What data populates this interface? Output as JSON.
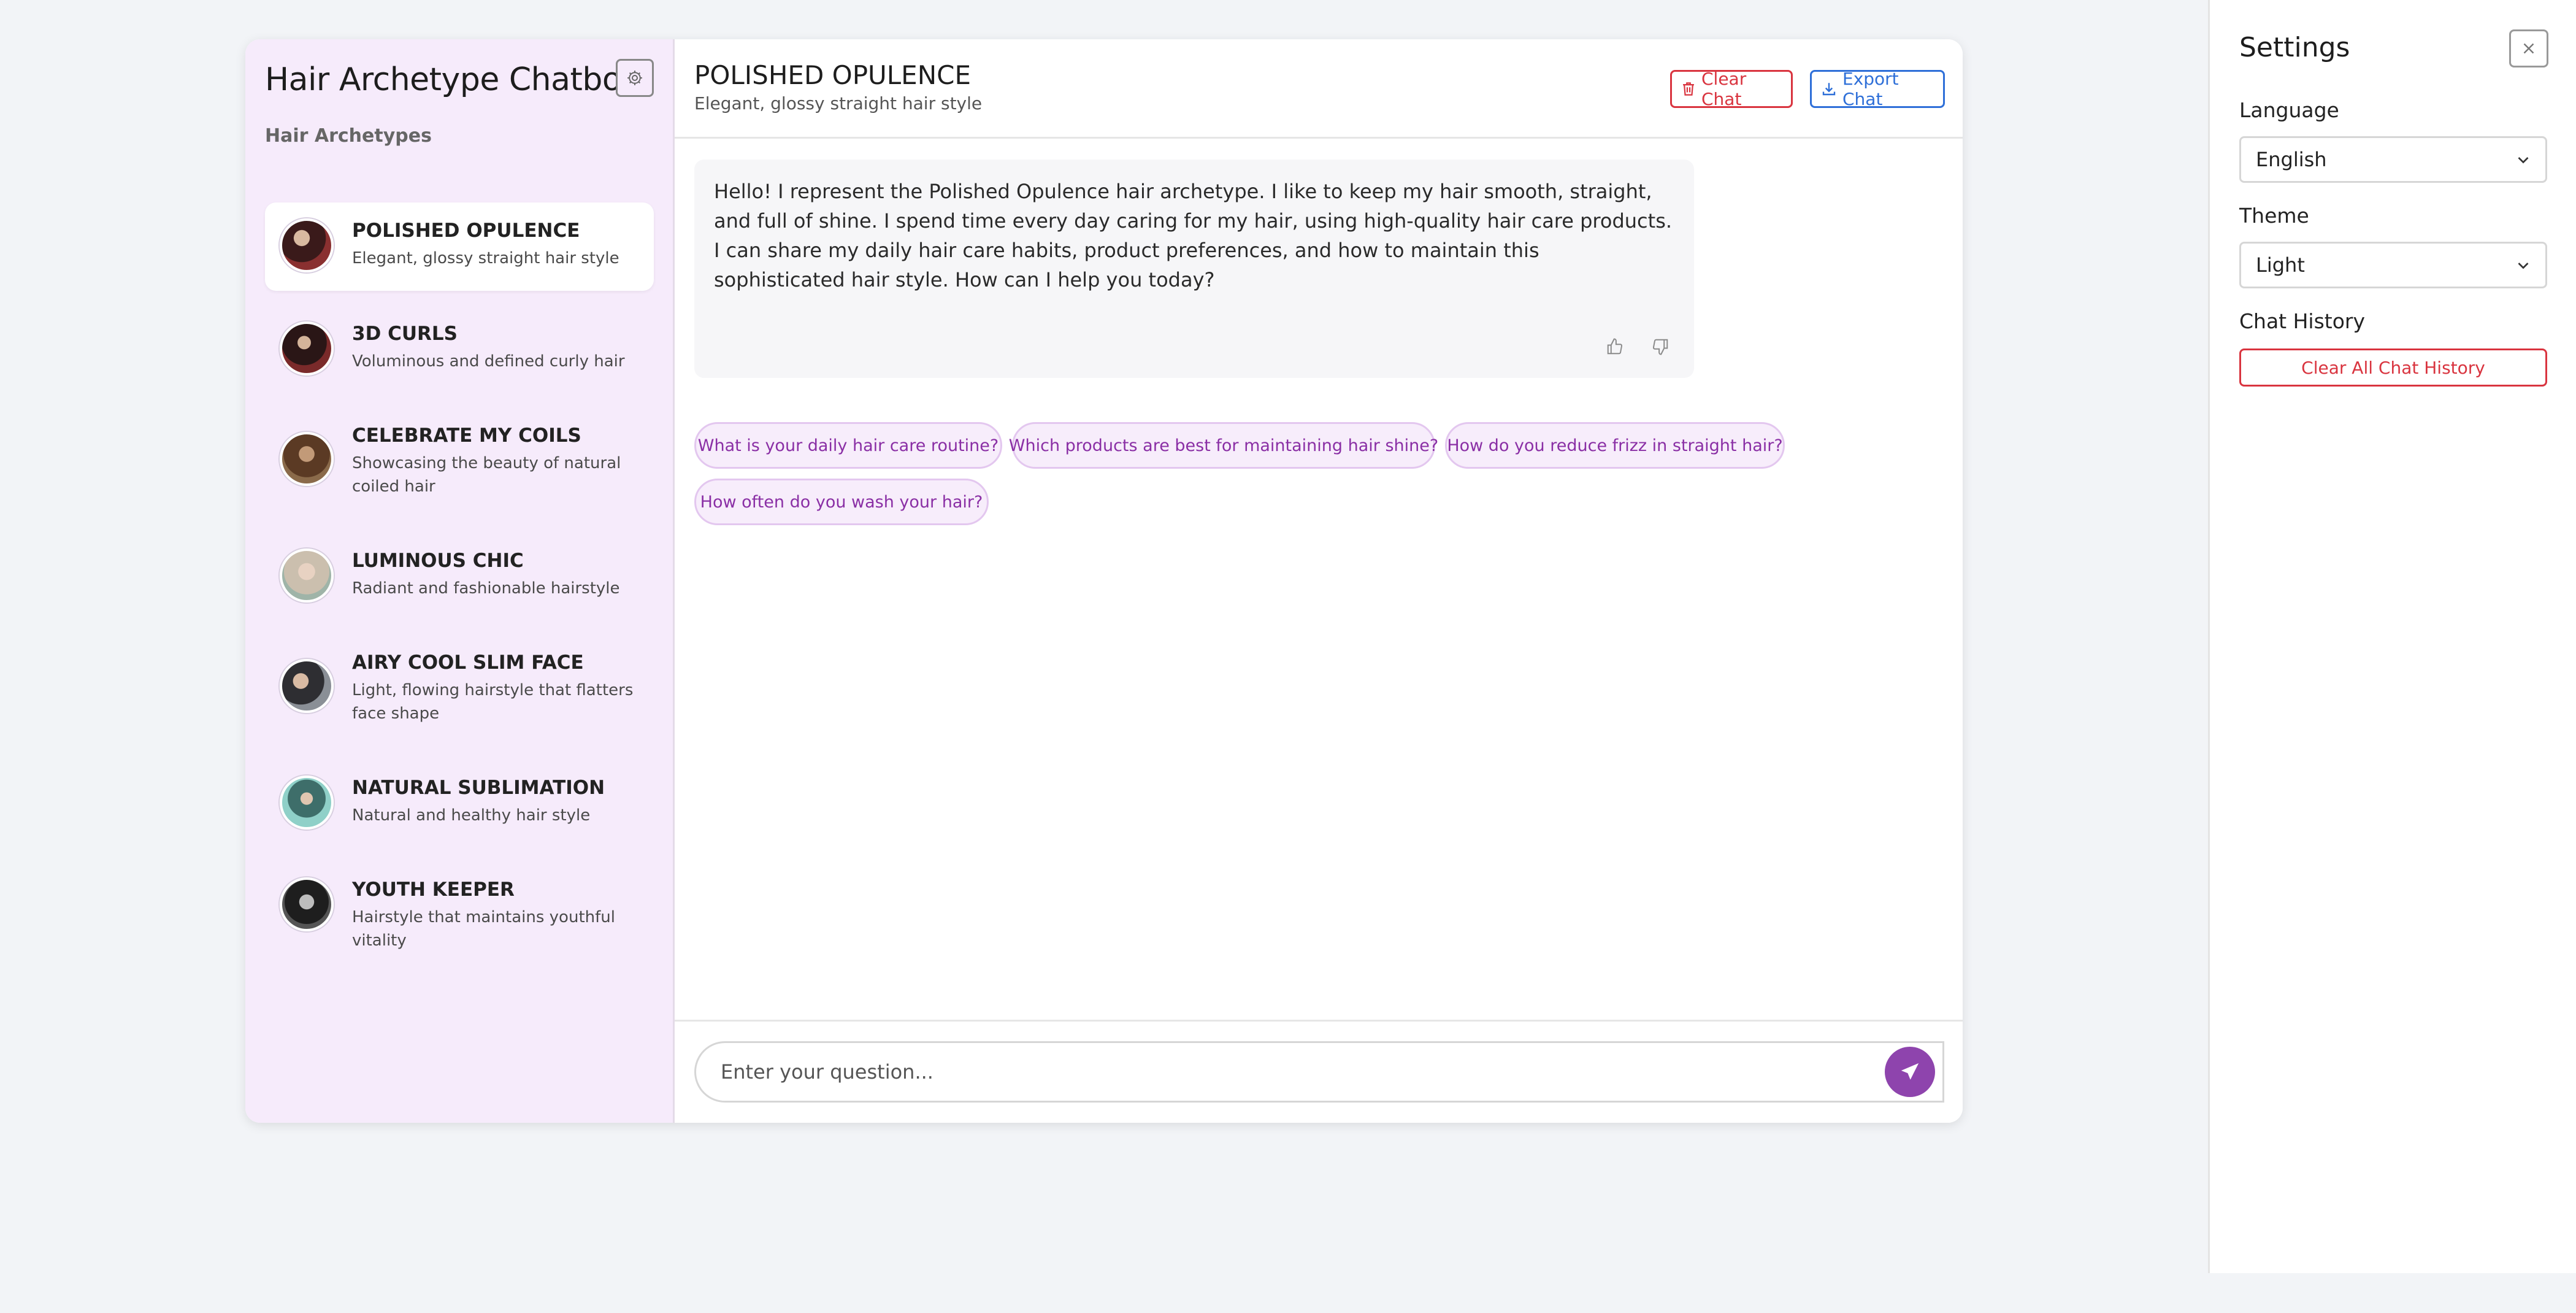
{
  "sidebar": {
    "title": "Hair Archetype Chatbot",
    "section_label": "Hair Archetypes",
    "items": [
      {
        "name": "POLISHED OPULENCE",
        "desc": "Elegant, glossy straight hair style",
        "avatar_color": "#5a2a2a"
      },
      {
        "name": "3D CURLS",
        "desc": "Voluminous and defined curly hair",
        "avatar_color": "#4a2424"
      },
      {
        "name": "CELEBRATE MY COILS",
        "desc": "Showcasing the beauty of natural coiled hair",
        "avatar_color": "#6a4a32"
      },
      {
        "name": "LUMINOUS CHIC",
        "desc": "Radiant and fashionable hairstyle",
        "avatar_color": "#cfc3b3"
      },
      {
        "name": "AIRY COOL SLIM FACE",
        "desc": "Light, flowing hairstyle that flatters face shape",
        "avatar_color": "#44444a"
      },
      {
        "name": "NATURAL SUBLIMATION",
        "desc": "Natural and healthy hair style",
        "avatar_color": "#5aa6a0"
      },
      {
        "name": "YOUTH KEEPER",
        "desc": "Hairstyle that maintains youthful vitality",
        "avatar_color": "#2c2c2c"
      }
    ]
  },
  "chat": {
    "title": "POLISHED OPULENCE",
    "subtitle": "Elegant, glossy straight hair style",
    "clear_label": "Clear Chat",
    "export_label": "Export Chat",
    "message": "Hello! I represent the Polished Opulence hair archetype. I like to keep my hair smooth, straight, and full of shine. I spend time every day caring for my hair, using high-quality hair care products. I can share my daily hair care habits, product preferences, and how to maintain this sophisticated hair style. How can I help you today?",
    "suggestions": [
      "What is your daily hair care routine?",
      "Which products are best for maintaining hair shine?",
      "How do you reduce frizz in straight hair?",
      "How often do you wash your hair?"
    ],
    "input_placeholder": "Enter your question..."
  },
  "settings": {
    "title": "Settings",
    "language_label": "Language",
    "language_value": "English",
    "theme_label": "Theme",
    "theme_value": "Light",
    "history_label": "Chat History",
    "clear_history_label": "Clear All Chat History"
  },
  "colors": {
    "accent": "#8e44ad",
    "danger": "#d9343f",
    "primary": "#2e6fd8",
    "sidebar_bg": "#f6ebfb"
  }
}
